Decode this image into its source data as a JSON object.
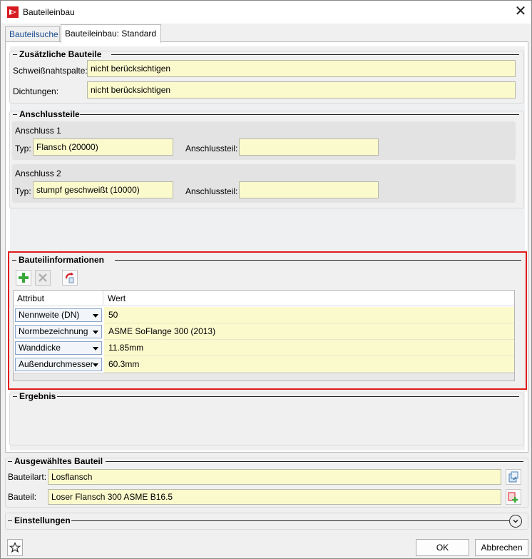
{
  "window": {
    "title": "Bauteileinbau",
    "close_glyph": "✕"
  },
  "tabs": [
    {
      "label": "Bauteilsuche",
      "active": false
    },
    {
      "label": "Bauteileinbau: Standard",
      "active": true
    }
  ],
  "zusaetzliche": {
    "heading": "Zusätzliche Bauteile",
    "fields": [
      {
        "label": "Schweißnahtspalte:",
        "value": "nicht berücksichtigen"
      },
      {
        "label": "Dichtungen:",
        "value": "nicht berücksichtigen"
      }
    ]
  },
  "anschlussteile": {
    "heading": "Anschlussteile",
    "anschluss": [
      {
        "title": "Anschluss 1",
        "typ_label": "Typ:",
        "typ_value": "Flansch (20000)",
        "teil_label": "Anschlussteil:",
        "teil_value": ""
      },
      {
        "title": "Anschluss 2",
        "typ_label": "Typ:",
        "typ_value": "stumpf geschweißt (10000)",
        "teil_label": "Anschlussteil:",
        "teil_value": ""
      }
    ]
  },
  "bauteilinfo": {
    "heading": "Bauteilinformationen",
    "toolbar": [
      "add-icon",
      "delete-icon",
      "reset-icon"
    ],
    "columns": [
      "Attribut",
      "Wert"
    ],
    "rows": [
      {
        "attribut": "Nennweite (DN)",
        "wert": "50"
      },
      {
        "attribut": "Normbezeichnung",
        "wert": "ASME SoFlange 300 (2013)"
      },
      {
        "attribut": "Wanddicke",
        "wert": "11.85mm"
      },
      {
        "attribut": "Außendurchmesser",
        "wert": "60.3mm"
      }
    ]
  },
  "ergebnis": {
    "heading": "Ergebnis"
  },
  "ausgewaehlt": {
    "heading": "Ausgewähltes Bauteil",
    "fields": [
      {
        "label": "Bauteilart:",
        "value": "Losflansch",
        "icon": "catalog-icon"
      },
      {
        "label": "Bauteil:",
        "value": "Loser Flansch 300 ASME B16.5",
        "icon": "add-part-icon"
      }
    ]
  },
  "einstellungen": {
    "heading": "Einstellungen"
  },
  "footer": {
    "ok_label": "OK",
    "cancel_label": "Abbrechen",
    "favorite_icon": "star-icon"
  },
  "colors": {
    "field_bg": "#fbfacd",
    "highlight_border": "#e31b1b",
    "tab_link": "#1a4d91"
  }
}
